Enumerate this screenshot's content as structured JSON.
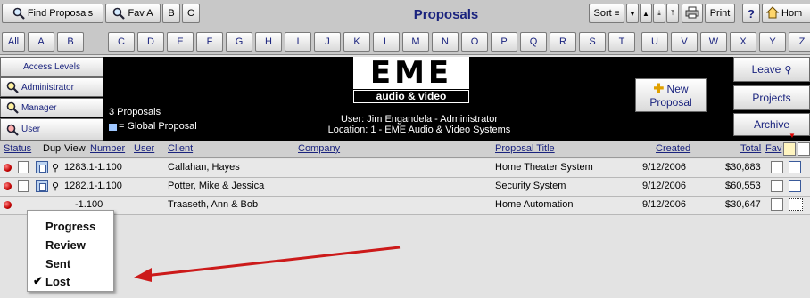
{
  "toolbar": {
    "find_proposals": "Find Proposals",
    "fav_a": "Fav A",
    "b": "B",
    "c": "C",
    "title": "Proposals",
    "sort": "Sort",
    "print": "Print",
    "help": "?",
    "home": "Hom"
  },
  "alphabet": [
    "All",
    "A",
    "B",
    "C",
    "D",
    "E",
    "F",
    "G",
    "H",
    "I",
    "J",
    "K",
    "L",
    "M",
    "N",
    "O",
    "P",
    "Q",
    "R",
    "S",
    "T",
    "U",
    "V",
    "W",
    "X",
    "Y",
    "Z"
  ],
  "left_menu": {
    "access_levels": "Access Levels",
    "administrator": "Administrator",
    "manager": "Manager",
    "user": "User"
  },
  "header": {
    "logo_top": "EME",
    "logo_sub": "audio & video",
    "count": "3 Proposals",
    "legend": "= Global Proposal",
    "user_line": "User: Jim Engandela - Administrator",
    "location_line": "Location: 1 - EME Audio & Video Systems",
    "new_proposal_1": "New",
    "new_proposal_2": "Proposal"
  },
  "right_menu": {
    "leave": "Leave",
    "projects": "Projects",
    "archive": "Archive"
  },
  "columns": {
    "status": "Status",
    "dup": "Dup",
    "view": "View",
    "number": "Number",
    "user": "User",
    "client": "Client",
    "company": "Company",
    "title": "Proposal Title",
    "created": "Created",
    "total": "Total",
    "fav": "Fav"
  },
  "rows": [
    {
      "number": "1283.1-1.100",
      "client": "Callahan, Hayes",
      "title": "Home Theater System",
      "created": "9/12/2006",
      "total": "$30,883"
    },
    {
      "number": "1282.1-1.100",
      "client": "Potter, Mike & Jessica",
      "title": "Security System",
      "created": "9/12/2006",
      "total": "$60,553"
    },
    {
      "number": "-1.100",
      "client": "Traaseth, Ann & Bob",
      "title": "Home Automation",
      "created": "9/12/2006",
      "total": "$30,647"
    }
  ],
  "status_menu": {
    "items": [
      "Progress",
      "Review",
      "Sent",
      "Lost"
    ],
    "checked": "Lost"
  },
  "colors": {
    "accent_text": "#1a237e",
    "status_red": "#c00000",
    "annotation_arrow": "#cc1a1a"
  }
}
